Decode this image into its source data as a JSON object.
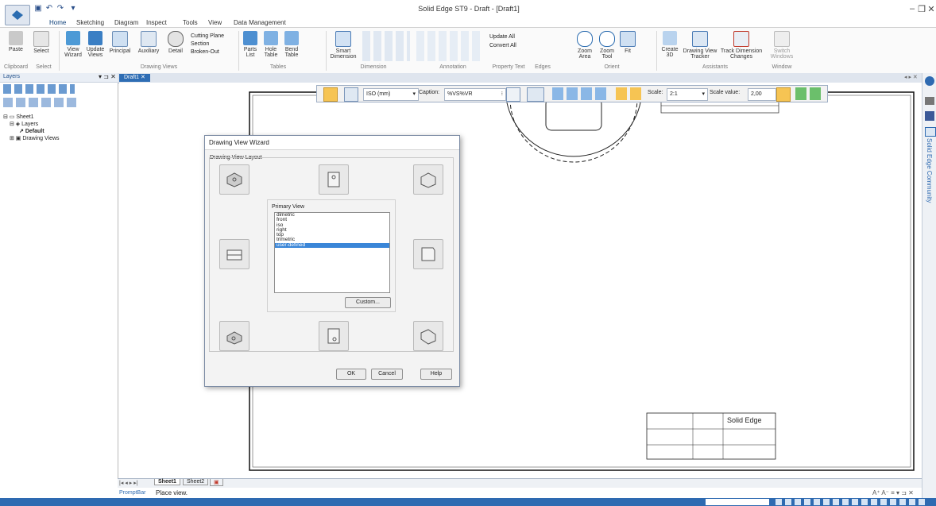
{
  "window": {
    "title": "Solid Edge ST9 - Draft - [Draft1]"
  },
  "tabs": [
    "Home",
    "Sketching",
    "Diagram",
    "Inspect",
    "Tools",
    "View",
    "Data Management"
  ],
  "ribbon": {
    "buttons": [
      {
        "label": "Paste"
      },
      {
        "label": "Select"
      },
      {
        "label": "View\nWizard"
      },
      {
        "label": "Update\nViews"
      },
      {
        "label": "Principal"
      },
      {
        "label": "Auxiliary"
      },
      {
        "label": "Detail"
      },
      {
        "label": "Parts\nList"
      },
      {
        "label": "Hole\nTable"
      },
      {
        "label": "Bend\nTable"
      },
      {
        "label": "Smart\nDimension"
      },
      {
        "label": "Zoom\nArea"
      },
      {
        "label": "Zoom\nTool"
      },
      {
        "label": "Fit"
      },
      {
        "label": "Create\n3D"
      },
      {
        "label": "Drawing View\nTracker"
      },
      {
        "label": "Track Dimension\nChanges"
      },
      {
        "label": "Switch\nWindows"
      }
    ],
    "small": {
      "cutting_plane": "Cutting Plane",
      "section": "Section",
      "broken_out": "Broken-Out",
      "update_all": "Update All",
      "convert_all": "Convert All"
    },
    "groups": [
      "Clipboard",
      "Select",
      "Drawing Views",
      "Tables",
      "Dimension",
      "Annotation",
      "Property Text",
      "Edges",
      "Orient",
      "Assistants",
      "Window"
    ]
  },
  "left_panel": {
    "title": "Layers",
    "tree": [
      "Sheet1",
      "Layers",
      "Default",
      "Drawing Views"
    ]
  },
  "doc_tab": "Draft1",
  "command_bar": {
    "standard": "ISO (mm)",
    "caption_label": "Caption:",
    "caption_value": "%VS%VR",
    "scale_label": "Scale:",
    "scale_value_sel": "2:1",
    "scale_value_label": "Scale value:",
    "scale_value": "2,00"
  },
  "dialog": {
    "title": "Drawing View Wizard",
    "group_label": "Drawing View Layout",
    "primary_view_label": "Primary View",
    "views": [
      "dimetric",
      "front",
      "iso",
      "right",
      "top",
      "trimetric",
      "user-defined"
    ],
    "selected": "user-defined",
    "custom_btn": "Custom...",
    "ok": "OK",
    "cancel": "Cancel",
    "help": "Help"
  },
  "title_block": {
    "company": "Solid Edge"
  },
  "sheets": [
    "Sheet1",
    "Sheet2"
  ],
  "prompt": {
    "label": "PromptBar",
    "text": "Place view."
  },
  "right_bar": {
    "community": "Solid Edge Community"
  }
}
